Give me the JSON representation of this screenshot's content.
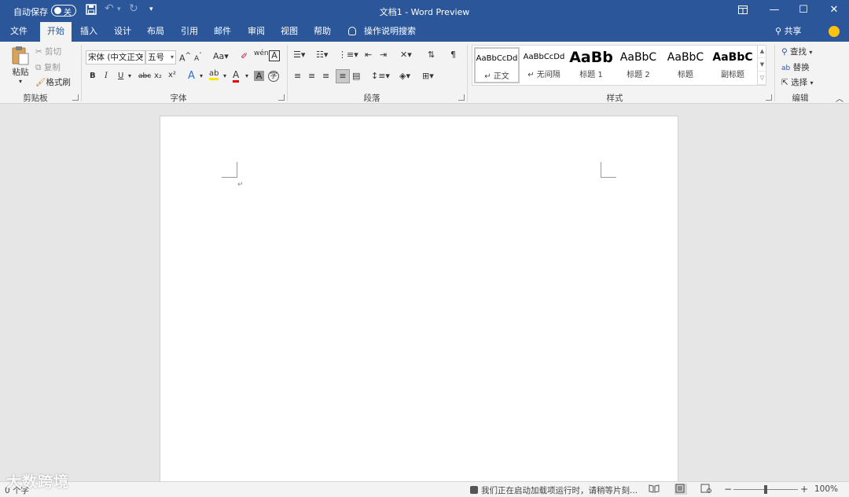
{
  "colors": {
    "brand": "#2b579a",
    "ribbon": "#f3f3f3",
    "canvas": "#e6e6e6"
  },
  "titlebar": {
    "autosave_label": "自动保存",
    "autosave_state": "关",
    "doc_title": "文档1  -  Word Preview"
  },
  "tabs": [
    "文件",
    "开始",
    "插入",
    "设计",
    "布局",
    "引用",
    "邮件",
    "审阅",
    "视图",
    "帮助"
  ],
  "active_tab": "开始",
  "tell_me": "操作说明搜索",
  "share": "共享",
  "clipboard": {
    "paste": "粘贴",
    "cut": "剪切",
    "copy": "复制",
    "format_painter": "格式刷",
    "label": "剪贴板"
  },
  "font": {
    "font_name": "宋体 (中文正文",
    "font_size": "五号",
    "label": "字体"
  },
  "paragraph": {
    "label": "段落"
  },
  "styles": {
    "label": "样式",
    "items": [
      {
        "preview": "AaBbCcDd",
        "name": "↵ 正文"
      },
      {
        "preview": "AaBbCcDd",
        "name": "↵ 无间隔"
      },
      {
        "preview": "AaBb",
        "name": "标题 1"
      },
      {
        "preview": "AaBbC",
        "name": "标题 2"
      },
      {
        "preview": "AaBbC",
        "name": "标题"
      },
      {
        "preview": "AaBbC",
        "name": "副标题"
      }
    ]
  },
  "editing": {
    "find": "查找",
    "replace": "替换",
    "select": "选择",
    "label": "编辑"
  },
  "status": {
    "word_count": "0 个字",
    "loading_message": "我们正在启动加载项运行时，请稍等片刻...",
    "zoom": "100%"
  },
  "watermark": "大数跨境"
}
